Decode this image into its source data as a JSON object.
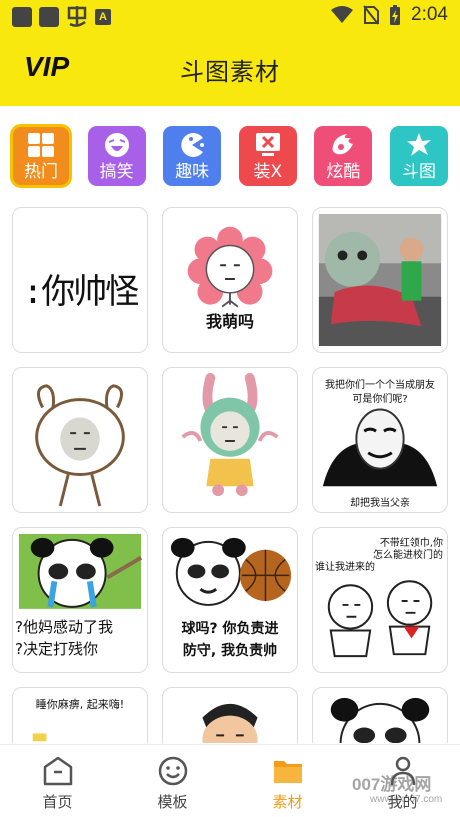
{
  "status_bar": {
    "time": "2:04",
    "notif_letter": "A"
  },
  "header": {
    "vip_label": "VIP",
    "title": "斗图素材"
  },
  "categories": [
    {
      "label": "热门",
      "color": "#f28c1c",
      "icon": "grid-icon",
      "active": true
    },
    {
      "label": "搞笑",
      "color": "#a860e8",
      "icon": "laugh-face-icon",
      "active": false
    },
    {
      "label": "趣味",
      "color": "#4f7fec",
      "icon": "pacman-icon",
      "active": false
    },
    {
      "label": "装X",
      "color": "#ee4a4e",
      "icon": "screen-x-icon",
      "active": false
    },
    {
      "label": "炫酷",
      "color": "#ee4e78",
      "icon": "flame-icon",
      "active": false
    },
    {
      "label": "斗图",
      "color": "#2ec6c4",
      "icon": "star-splash-icon",
      "active": false
    }
  ],
  "memes": [
    {
      "text": ":你帅怪"
    },
    {
      "text": "我萌吗"
    },
    {
      "text": ""
    },
    {
      "text": ""
    },
    {
      "text": ""
    },
    {
      "text_top": "我把你们一个个当成朋友",
      "text_mid": "可是你们呢?",
      "text_bottom": "却把我当父亲"
    },
    {
      "text_line1": "?他妈感动了我",
      "text_line2": "?决定打残你"
    },
    {
      "text_line1": "球吗? 你负责进",
      "text_line2": "防守, 我负责帅"
    },
    {
      "text_right1": "不带红领巾,你",
      "text_right2": "怎么能进校门的",
      "text_left": "谁让我进来的"
    },
    {
      "text": "睡你麻痹, 起来嗨!"
    },
    {
      "text": ""
    },
    {
      "text": ""
    }
  ],
  "bottom_nav": [
    {
      "label": "首页",
      "icon": "home-icon",
      "active": false
    },
    {
      "label": "模板",
      "icon": "smile-icon",
      "active": false
    },
    {
      "label": "素材",
      "icon": "folder-icon",
      "active": true
    },
    {
      "label": "我的",
      "icon": "user-icon",
      "active": false
    }
  ],
  "watermark": {
    "big": "007游戏网",
    "small": "www.yx007.com"
  },
  "colors": {
    "header_yellow": "#f9e80e",
    "active_nav": "#f29c1a"
  }
}
